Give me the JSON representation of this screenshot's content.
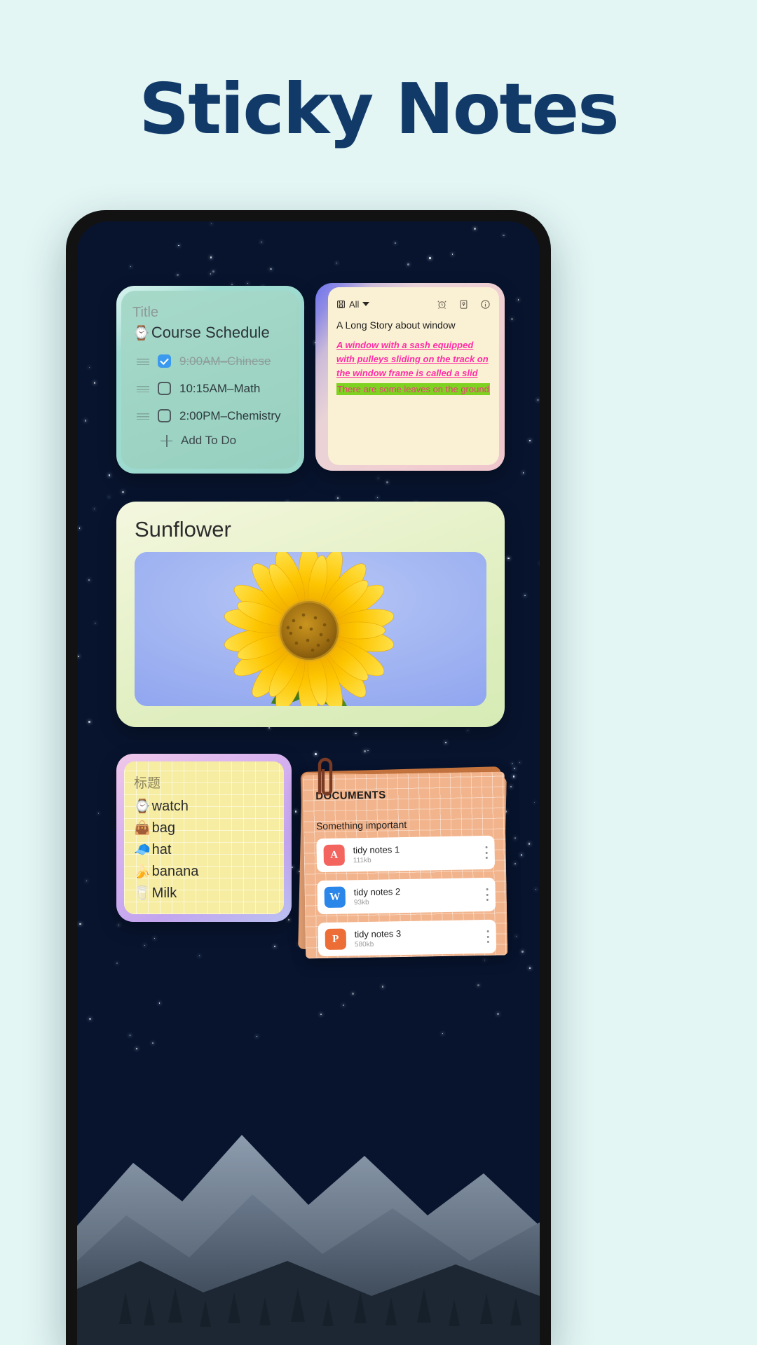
{
  "page": {
    "title": "Sticky Notes",
    "title_color": "#123a69",
    "background_color": "#e3f6f4"
  },
  "schedule_note": {
    "placeholder_title": "Title",
    "heading_icon": "watch-icon",
    "heading": "Course Schedule",
    "items": [
      {
        "label": "9:00AM–Chinese",
        "checked": true,
        "checkbox_color": "#3b9aee"
      },
      {
        "label": "10:15AM–Math",
        "checked": false,
        "checkbox_color": "#4e5b5e"
      },
      {
        "label": "2:00PM–Chemistry",
        "checked": false,
        "checkbox_color": "#4e5b5e"
      }
    ],
    "add_label": "Add To Do"
  },
  "story_note": {
    "toolbar": {
      "save_icon": "floppy-disk-icon",
      "filter_label": "All",
      "caret_icon": "chevron-down-icon",
      "alarm_icon": "alarm-clock-icon",
      "lock_icon": "lock-icon",
      "info_icon": "info-icon"
    },
    "title": "A Long Story about window",
    "highlight_pink": "A window with a sash equipped with pulleys sliding on the track on the window frame is called a slid",
    "highlight_green": "There are some leaves on the ground",
    "pink_color": "#ff2ea6",
    "green_color": "#7ed321"
  },
  "sunflower_note": {
    "title": "Sunflower",
    "image_alt": "sunflower-photo"
  },
  "list_note": {
    "title": "标题",
    "items": [
      {
        "emoji": "⌚",
        "label": "watch"
      },
      {
        "emoji": "👜",
        "label": "bag"
      },
      {
        "emoji": "🧢",
        "label": "hat"
      },
      {
        "emoji": "🍌",
        "label": "banana"
      },
      {
        "emoji": "🥛",
        "label": "Milk"
      }
    ]
  },
  "documents_note": {
    "kicker": "DOCUMENTS",
    "subtitle": "Something important",
    "clip_icon": "paperclip-icon",
    "files": [
      {
        "name": "tidy notes 1",
        "size": "111kb",
        "type": "pdf",
        "icon_letter": "A",
        "icon_color": "#f4645f",
        "menu_icon": "kebab-menu-icon"
      },
      {
        "name": "tidy notes 2",
        "size": "93kb",
        "type": "word",
        "icon_letter": "W",
        "icon_color": "#2a86e8",
        "menu_icon": "kebab-menu-icon"
      },
      {
        "name": "tidy notes 3",
        "size": "580kb",
        "type": "ppt",
        "icon_letter": "P",
        "icon_color": "#ec6d35",
        "menu_icon": "kebab-menu-icon"
      }
    ]
  }
}
